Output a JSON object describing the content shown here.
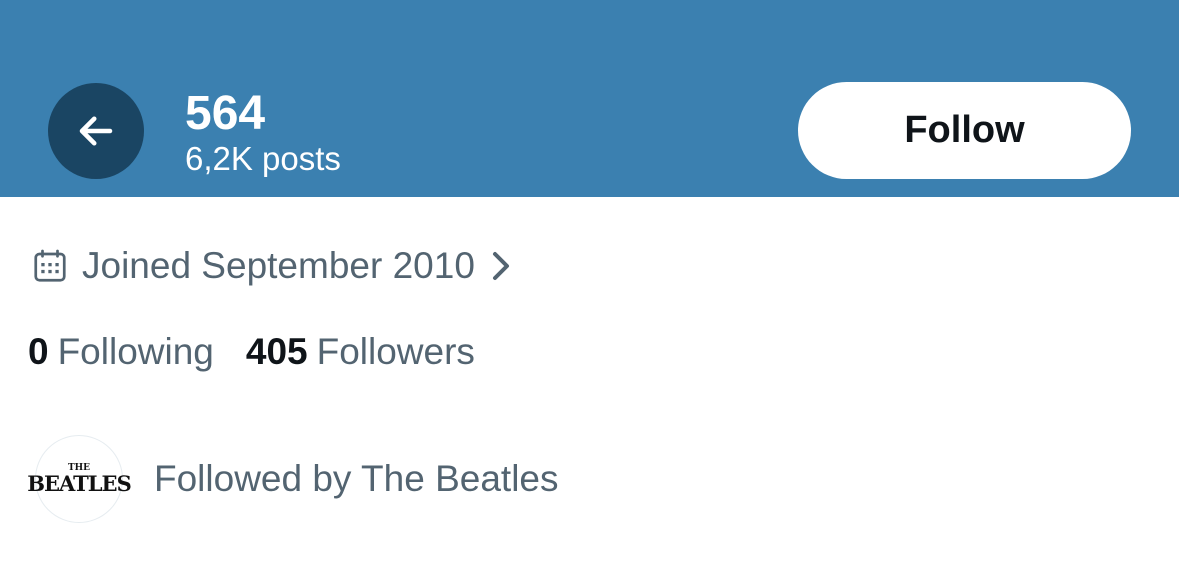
{
  "header": {
    "title": "564",
    "subtitle": "6,2K posts",
    "follow_label": "Follow",
    "colors": {
      "banner": "#3b80b0",
      "back_button": "#1a4563"
    },
    "icons": {
      "back": "arrow-left-icon"
    }
  },
  "profile": {
    "joined_text": "Joined September 2010",
    "icons": {
      "joined": "calendar-icon",
      "joined_more": "chevron-right-icon"
    },
    "stats": [
      {
        "value": "0",
        "label": "Following"
      },
      {
        "value": "405",
        "label": "Followers"
      }
    ],
    "followed_by": {
      "avatar_text_small": "THE",
      "avatar_text_large": "BEATLES",
      "text": "Followed by The Beatles"
    }
  }
}
